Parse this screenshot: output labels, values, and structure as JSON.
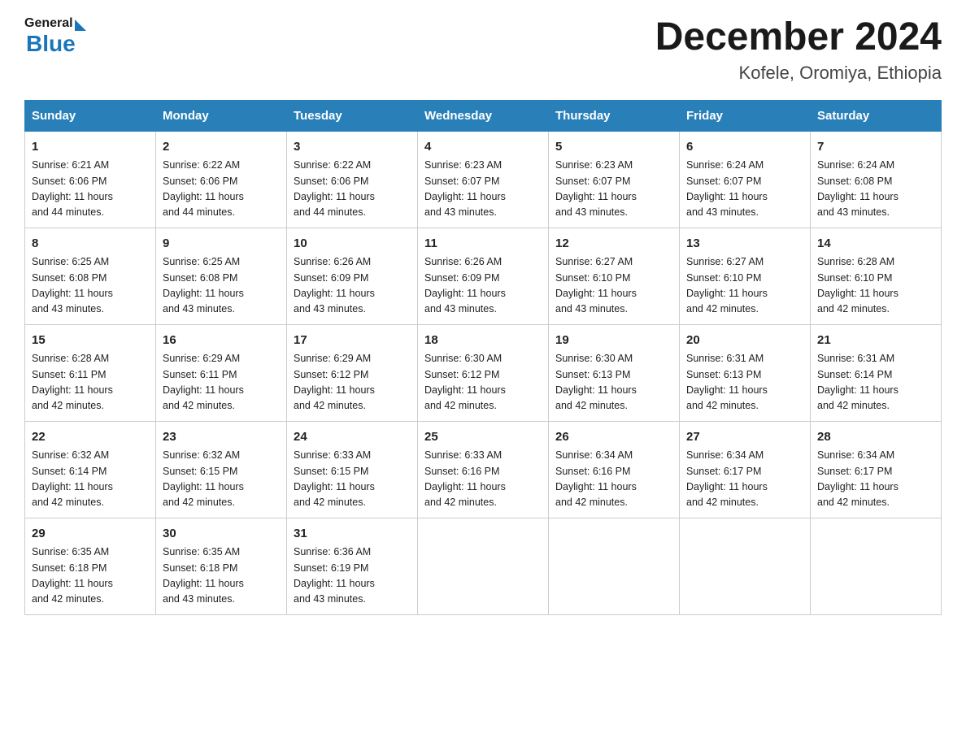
{
  "header": {
    "logo_general": "General",
    "logo_blue": "Blue",
    "month_year": "December 2024",
    "location": "Kofele, Oromiya, Ethiopia"
  },
  "weekdays": [
    "Sunday",
    "Monday",
    "Tuesday",
    "Wednesday",
    "Thursday",
    "Friday",
    "Saturday"
  ],
  "weeks": [
    [
      {
        "day": "1",
        "sunrise": "6:21 AM",
        "sunset": "6:06 PM",
        "daylight": "11 hours and 44 minutes."
      },
      {
        "day": "2",
        "sunrise": "6:22 AM",
        "sunset": "6:06 PM",
        "daylight": "11 hours and 44 minutes."
      },
      {
        "day": "3",
        "sunrise": "6:22 AM",
        "sunset": "6:06 PM",
        "daylight": "11 hours and 44 minutes."
      },
      {
        "day": "4",
        "sunrise": "6:23 AM",
        "sunset": "6:07 PM",
        "daylight": "11 hours and 43 minutes."
      },
      {
        "day": "5",
        "sunrise": "6:23 AM",
        "sunset": "6:07 PM",
        "daylight": "11 hours and 43 minutes."
      },
      {
        "day": "6",
        "sunrise": "6:24 AM",
        "sunset": "6:07 PM",
        "daylight": "11 hours and 43 minutes."
      },
      {
        "day": "7",
        "sunrise": "6:24 AM",
        "sunset": "6:08 PM",
        "daylight": "11 hours and 43 minutes."
      }
    ],
    [
      {
        "day": "8",
        "sunrise": "6:25 AM",
        "sunset": "6:08 PM",
        "daylight": "11 hours and 43 minutes."
      },
      {
        "day": "9",
        "sunrise": "6:25 AM",
        "sunset": "6:08 PM",
        "daylight": "11 hours and 43 minutes."
      },
      {
        "day": "10",
        "sunrise": "6:26 AM",
        "sunset": "6:09 PM",
        "daylight": "11 hours and 43 minutes."
      },
      {
        "day": "11",
        "sunrise": "6:26 AM",
        "sunset": "6:09 PM",
        "daylight": "11 hours and 43 minutes."
      },
      {
        "day": "12",
        "sunrise": "6:27 AM",
        "sunset": "6:10 PM",
        "daylight": "11 hours and 43 minutes."
      },
      {
        "day": "13",
        "sunrise": "6:27 AM",
        "sunset": "6:10 PM",
        "daylight": "11 hours and 42 minutes."
      },
      {
        "day": "14",
        "sunrise": "6:28 AM",
        "sunset": "6:10 PM",
        "daylight": "11 hours and 42 minutes."
      }
    ],
    [
      {
        "day": "15",
        "sunrise": "6:28 AM",
        "sunset": "6:11 PM",
        "daylight": "11 hours and 42 minutes."
      },
      {
        "day": "16",
        "sunrise": "6:29 AM",
        "sunset": "6:11 PM",
        "daylight": "11 hours and 42 minutes."
      },
      {
        "day": "17",
        "sunrise": "6:29 AM",
        "sunset": "6:12 PM",
        "daylight": "11 hours and 42 minutes."
      },
      {
        "day": "18",
        "sunrise": "6:30 AM",
        "sunset": "6:12 PM",
        "daylight": "11 hours and 42 minutes."
      },
      {
        "day": "19",
        "sunrise": "6:30 AM",
        "sunset": "6:13 PM",
        "daylight": "11 hours and 42 minutes."
      },
      {
        "day": "20",
        "sunrise": "6:31 AM",
        "sunset": "6:13 PM",
        "daylight": "11 hours and 42 minutes."
      },
      {
        "day": "21",
        "sunrise": "6:31 AM",
        "sunset": "6:14 PM",
        "daylight": "11 hours and 42 minutes."
      }
    ],
    [
      {
        "day": "22",
        "sunrise": "6:32 AM",
        "sunset": "6:14 PM",
        "daylight": "11 hours and 42 minutes."
      },
      {
        "day": "23",
        "sunrise": "6:32 AM",
        "sunset": "6:15 PM",
        "daylight": "11 hours and 42 minutes."
      },
      {
        "day": "24",
        "sunrise": "6:33 AM",
        "sunset": "6:15 PM",
        "daylight": "11 hours and 42 minutes."
      },
      {
        "day": "25",
        "sunrise": "6:33 AM",
        "sunset": "6:16 PM",
        "daylight": "11 hours and 42 minutes."
      },
      {
        "day": "26",
        "sunrise": "6:34 AM",
        "sunset": "6:16 PM",
        "daylight": "11 hours and 42 minutes."
      },
      {
        "day": "27",
        "sunrise": "6:34 AM",
        "sunset": "6:17 PM",
        "daylight": "11 hours and 42 minutes."
      },
      {
        "day": "28",
        "sunrise": "6:34 AM",
        "sunset": "6:17 PM",
        "daylight": "11 hours and 42 minutes."
      }
    ],
    [
      {
        "day": "29",
        "sunrise": "6:35 AM",
        "sunset": "6:18 PM",
        "daylight": "11 hours and 42 minutes."
      },
      {
        "day": "30",
        "sunrise": "6:35 AM",
        "sunset": "6:18 PM",
        "daylight": "11 hours and 43 minutes."
      },
      {
        "day": "31",
        "sunrise": "6:36 AM",
        "sunset": "6:19 PM",
        "daylight": "11 hours and 43 minutes."
      },
      null,
      null,
      null,
      null
    ]
  ],
  "labels": {
    "sunrise": "Sunrise:",
    "sunset": "Sunset:",
    "daylight": "Daylight:"
  }
}
